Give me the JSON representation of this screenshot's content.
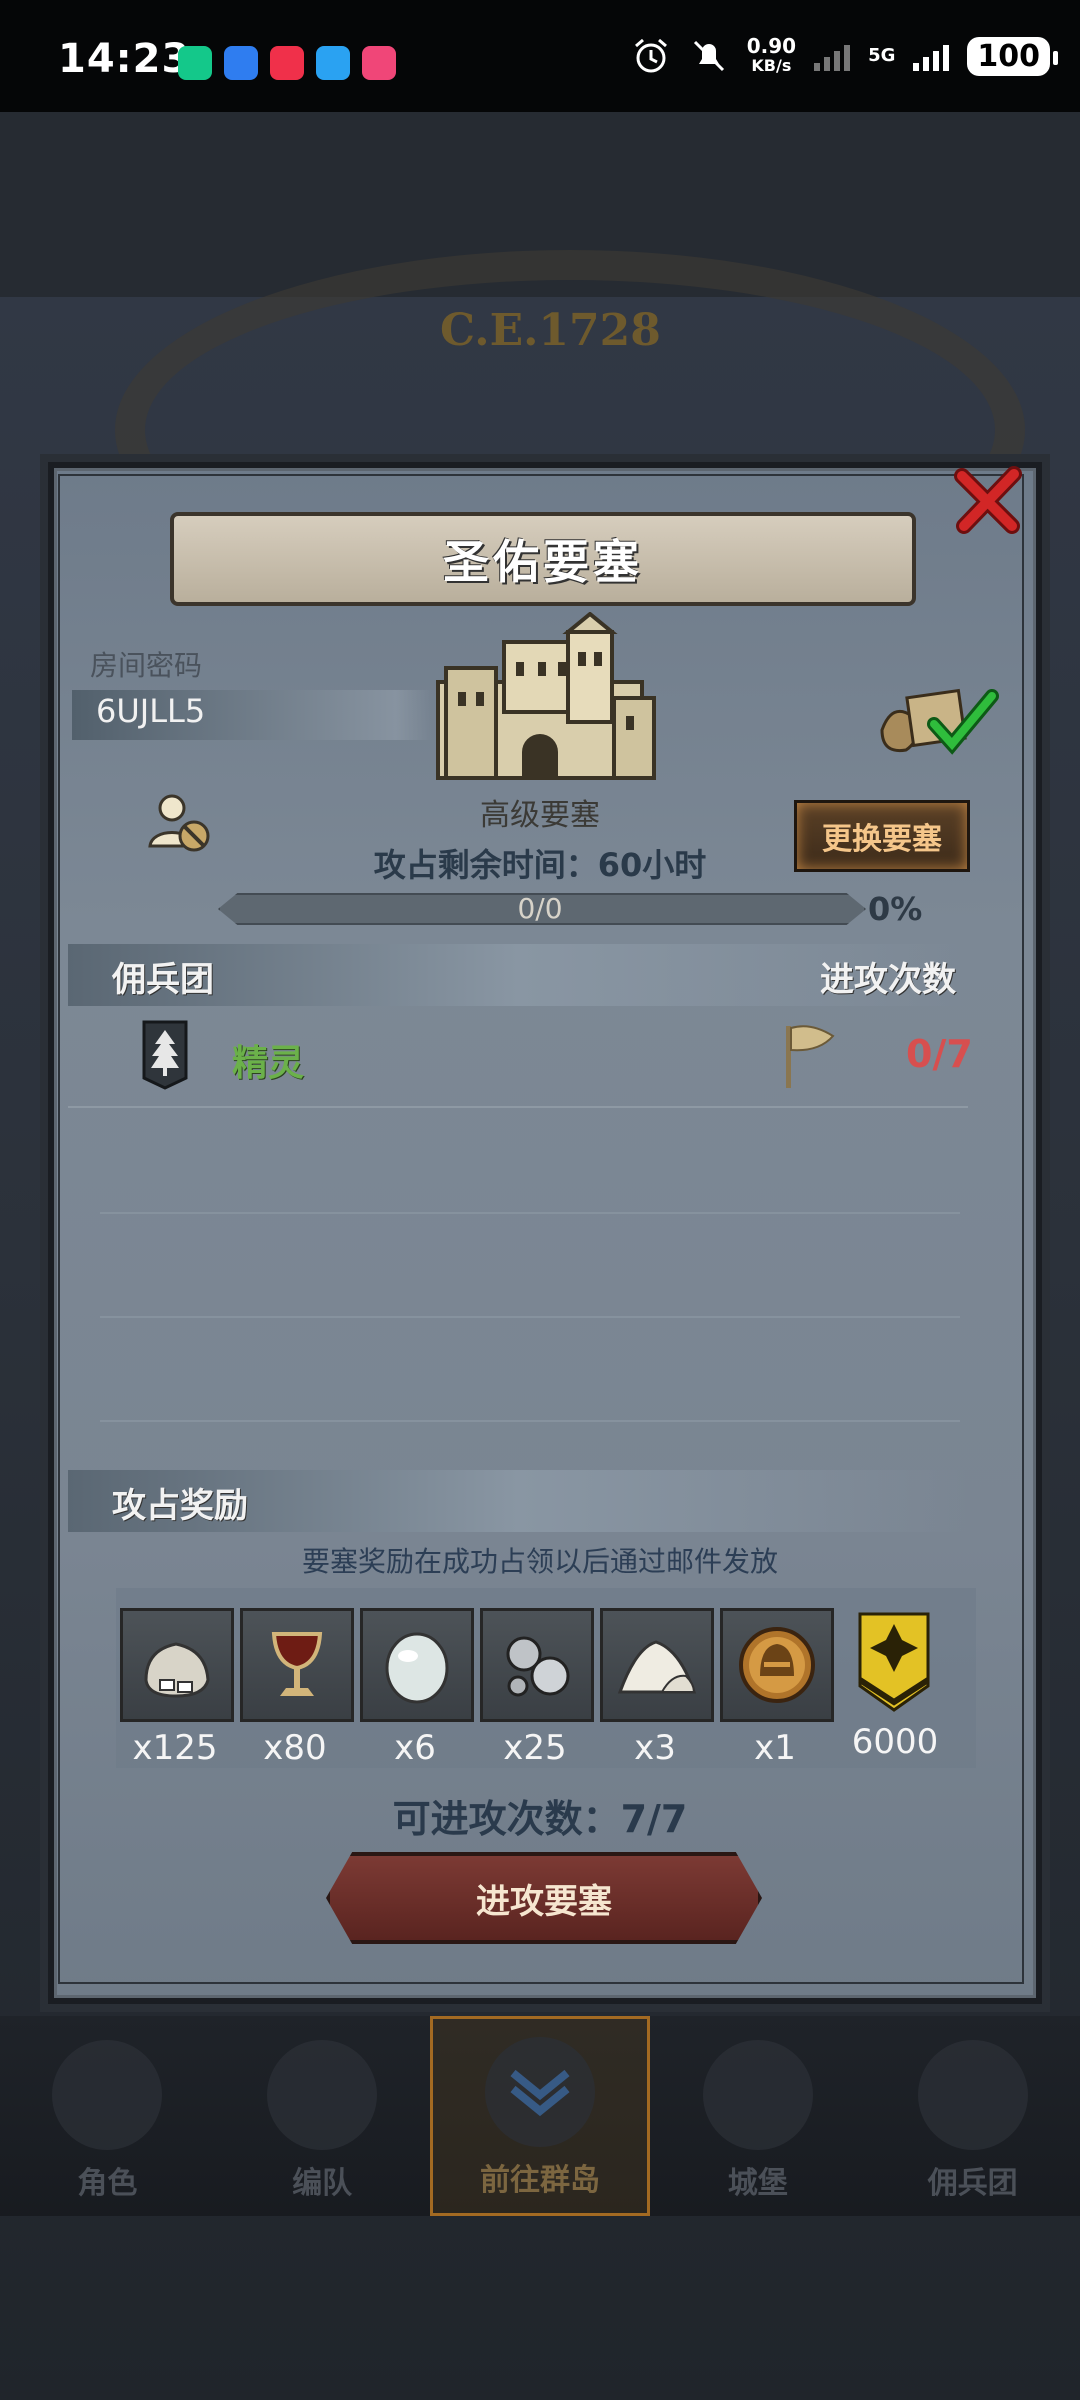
{
  "status_bar": {
    "time": "14:23",
    "net_speed_value": "0.90",
    "net_speed_unit": "KB/s",
    "network": "5G",
    "battery": "100"
  },
  "background": {
    "era_label": "C.E.1728"
  },
  "dialog": {
    "title": "圣佑要塞",
    "room_password_label": "房间密码",
    "room_password_value": "6UJLL5",
    "fortress_level": "高级要塞",
    "time_left": "攻占剩余时间：60小时",
    "change_button": "更换要塞",
    "progress_text": "0/0",
    "progress_percent": "0%",
    "progress_value": 0,
    "mercenary_header": "佣兵团",
    "attack_count_header": "进攻次数",
    "mercenary_name": "精灵",
    "mercenary_attack_count": "0/7",
    "reward_header": "攻占奖励",
    "reward_note": "要塞奖励在成功占领以后通过邮件发放",
    "rewards": [
      {
        "icon": "silver-sack-icon",
        "qty": "x125"
      },
      {
        "icon": "goblet-icon",
        "qty": "x80"
      },
      {
        "icon": "white-stone-icon",
        "qty": "x6"
      },
      {
        "icon": "silver-balls-icon",
        "qty": "x25"
      },
      {
        "icon": "salt-pile-icon",
        "qty": "x3"
      },
      {
        "icon": "helmet-medal-icon",
        "qty": "x1"
      },
      {
        "icon": "rank-badge-icon",
        "qty": "6000"
      }
    ],
    "attempts_left": "可进攻次数：7/7",
    "attack_button": "进攻要塞"
  },
  "bottom_nav": {
    "items": [
      {
        "label": "角色",
        "active": false
      },
      {
        "label": "编队",
        "active": false
      },
      {
        "label": "前往群岛",
        "active": true
      },
      {
        "label": "城堡",
        "active": false
      },
      {
        "label": "佣兵团",
        "active": false
      }
    ]
  },
  "colors": {
    "accent_green": "#6bb14a",
    "accent_red": "#d74f4f",
    "close_red": "#c81f1f",
    "attack_button": "#7c3a34"
  }
}
